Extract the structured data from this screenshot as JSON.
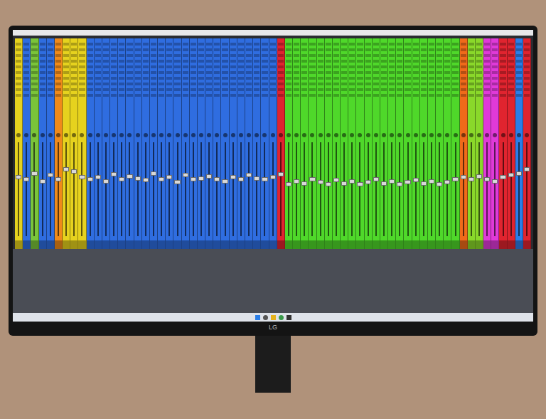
{
  "monitor": {
    "brand": "LG"
  },
  "channels": [
    {
      "color": "#e6d21e",
      "level": 0.62
    },
    {
      "color": "#2f6de0",
      "level": 0.6
    },
    {
      "color": "#7ac43a",
      "level": 0.66
    },
    {
      "color": "#2f6de0",
      "level": 0.58
    },
    {
      "color": "#2f6de0",
      "level": 0.64
    },
    {
      "color": "#f08a1a",
      "level": 0.6
    },
    {
      "color": "#e6d21e",
      "level": 0.7
    },
    {
      "color": "#e6d21e",
      "level": 0.68
    },
    {
      "color": "#e6d21e",
      "level": 0.62
    },
    {
      "color": "#2f6de0",
      "level": 0.6
    },
    {
      "color": "#2f6de0",
      "level": 0.62
    },
    {
      "color": "#2f6de0",
      "level": 0.58
    },
    {
      "color": "#2f6de0",
      "level": 0.65
    },
    {
      "color": "#2f6de0",
      "level": 0.6
    },
    {
      "color": "#2f6de0",
      "level": 0.63
    },
    {
      "color": "#2f6de0",
      "level": 0.61
    },
    {
      "color": "#2f6de0",
      "level": 0.59
    },
    {
      "color": "#2f6de0",
      "level": 0.66
    },
    {
      "color": "#2f6de0",
      "level": 0.6
    },
    {
      "color": "#2f6de0",
      "level": 0.62
    },
    {
      "color": "#2f6de0",
      "level": 0.57
    },
    {
      "color": "#2f6de0",
      "level": 0.64
    },
    {
      "color": "#2f6de0",
      "level": 0.6
    },
    {
      "color": "#2f6de0",
      "level": 0.61
    },
    {
      "color": "#2f6de0",
      "level": 0.63
    },
    {
      "color": "#2f6de0",
      "level": 0.6
    },
    {
      "color": "#2f6de0",
      "level": 0.58
    },
    {
      "color": "#2f6de0",
      "level": 0.62
    },
    {
      "color": "#2f6de0",
      "level": 0.6
    },
    {
      "color": "#2f6de0",
      "level": 0.64
    },
    {
      "color": "#2f6de0",
      "level": 0.61
    },
    {
      "color": "#2f6de0",
      "level": 0.6
    },
    {
      "color": "#2f6de0",
      "level": 0.62
    },
    {
      "color": "#e0242f",
      "level": 0.65
    },
    {
      "color": "#4fd82a",
      "level": 0.55
    },
    {
      "color": "#4fd82a",
      "level": 0.58
    },
    {
      "color": "#4fd82a",
      "level": 0.56
    },
    {
      "color": "#4fd82a",
      "level": 0.6
    },
    {
      "color": "#4fd82a",
      "level": 0.57
    },
    {
      "color": "#4fd82a",
      "level": 0.55
    },
    {
      "color": "#4fd82a",
      "level": 0.59
    },
    {
      "color": "#4fd82a",
      "level": 0.56
    },
    {
      "color": "#4fd82a",
      "level": 0.58
    },
    {
      "color": "#4fd82a",
      "level": 0.55
    },
    {
      "color": "#4fd82a",
      "level": 0.57
    },
    {
      "color": "#4fd82a",
      "level": 0.6
    },
    {
      "color": "#4fd82a",
      "level": 0.56
    },
    {
      "color": "#4fd82a",
      "level": 0.58
    },
    {
      "color": "#4fd82a",
      "level": 0.55
    },
    {
      "color": "#4fd82a",
      "level": 0.57
    },
    {
      "color": "#4fd82a",
      "level": 0.59
    },
    {
      "color": "#4fd82a",
      "level": 0.56
    },
    {
      "color": "#4fd82a",
      "level": 0.58
    },
    {
      "color": "#4fd82a",
      "level": 0.55
    },
    {
      "color": "#4fd82a",
      "level": 0.57
    },
    {
      "color": "#4fd82a",
      "level": 0.6
    },
    {
      "color": "#f06a1a",
      "level": 0.62
    },
    {
      "color": "#8ad82a",
      "level": 0.6
    },
    {
      "color": "#8ad82a",
      "level": 0.63
    },
    {
      "color": "#e03ad8",
      "level": 0.6
    },
    {
      "color": "#e03ad8",
      "level": 0.58
    },
    {
      "color": "#e0242f",
      "level": 0.62
    },
    {
      "color": "#e0242f",
      "level": 0.64
    },
    {
      "color": "#2a7ee8",
      "level": 0.66
    },
    {
      "color": "#e0242f",
      "level": 0.7
    }
  ]
}
